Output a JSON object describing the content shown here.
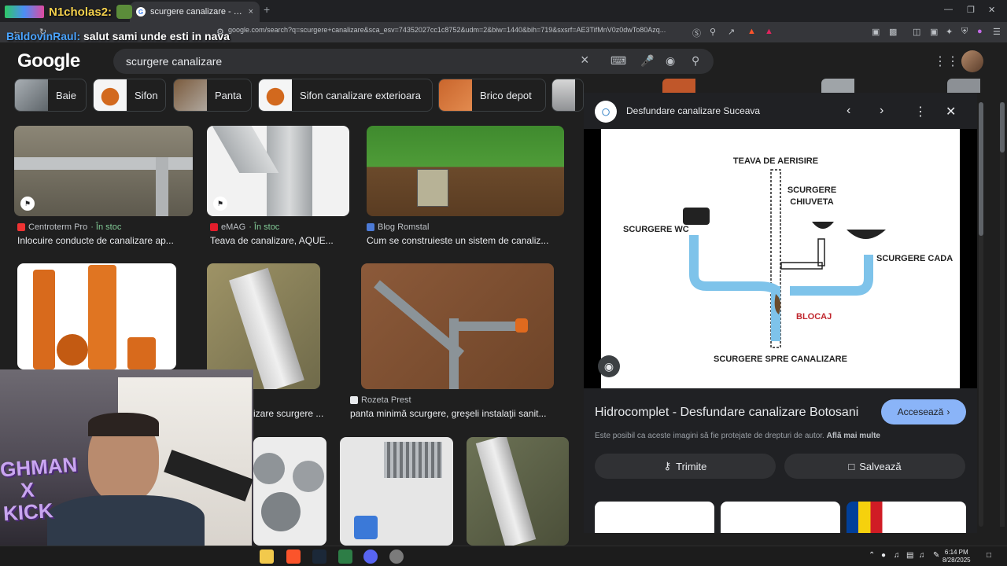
{
  "browser": {
    "tab_title": "scurgere canalizare - Căutare Go",
    "tab_close": "×",
    "new_tab": "+",
    "url": "google.com/search?q=scurgere+canalizare&sca_esv=74352027cc1c8752&udm=2&biw=1440&bih=719&sxsrf=AE3TifMnV0z0dwTo80Azq..."
  },
  "google": {
    "logo": "Google",
    "query": "scurgere canalizare",
    "clear_icon": "×"
  },
  "chips": [
    {
      "label": "Baie"
    },
    {
      "label": "Sifon"
    },
    {
      "label": "Panta"
    },
    {
      "label": "Sifon canalizare exterioara"
    },
    {
      "label": "Brico depot"
    }
  ],
  "results": [
    {
      "source": "Centroterm Pro",
      "stock": "· În stoc",
      "caption": "Inlocuire conducte de canalizare ap..."
    },
    {
      "source": "eMAG",
      "stock": "· În stoc",
      "caption": "Teava de canalizare, AQUE..."
    },
    {
      "source": "Blog Romstal",
      "stock": "",
      "caption": "Cum se construieste un sistem de canaliz..."
    },
    {
      "source": "Rozeta Prest",
      "stock": "",
      "caption": "panta minimă scurgere, greşeli instalaţii sanit..."
    },
    {
      "source": "",
      "stock": "",
      "caption": "izare scurgere ..."
    }
  ],
  "panel": {
    "site_name": "Desfundare canalizare Suceava",
    "result_title": "Hidrocomplet - Desfundare canalizare Botosani",
    "visit_label": "Accesează",
    "copyright_text": "Este posibil ca aceste imagini să fie protejate de drepturi de autor.",
    "learn_more": "Află mai multe",
    "share_label": "Trimite",
    "save_label": "Salvează",
    "diagram": {
      "vent": "TEAVA DE AERISIRE",
      "sink_line1": "SCURGERE",
      "sink_line2": "CHIUVETA",
      "wc": "SCURGERE WC",
      "tub": "SCURGERE CADA",
      "blockage": "BLOCAJ",
      "sewer": "SCURGERE SPRE CANALIZARE"
    }
  },
  "stream": {
    "user1": "N1cholas2:",
    "user2": "BaldovinRaul:",
    "message2": "salut sami unde esti in nava",
    "cam_text_line1": "GHMAN",
    "cam_text_line2": "X",
    "cam_text_line3": "KICK"
  },
  "taskbar": {
    "time": "6:14 PM",
    "date": "8/28/2025"
  },
  "colors": {
    "accent": "#8ab4f8",
    "stock_green": "#81c995",
    "pipe_blue": "#7ec3ea",
    "blockage_red": "#c0262d"
  }
}
